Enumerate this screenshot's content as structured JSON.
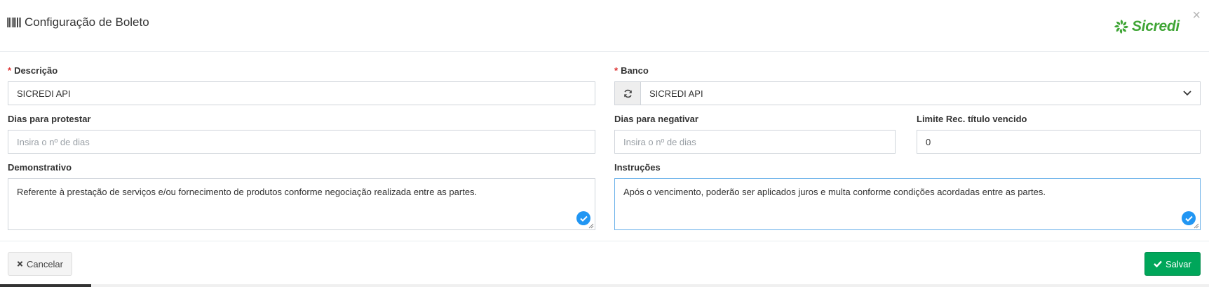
{
  "modal": {
    "title": "Configuração de Boleto",
    "close_symbol": "×",
    "brand": {
      "name": "Sicredi",
      "color": "#3fa535"
    }
  },
  "form": {
    "descricao": {
      "label": "Descrição",
      "required": "*",
      "value": "SICREDI API"
    },
    "banco": {
      "label": "Banco",
      "required": "*",
      "value": "SICREDI API"
    },
    "dias_protestar": {
      "label": "Dias para protestar",
      "placeholder": "Insira o nº de dias"
    },
    "dias_negativar": {
      "label": "Dias para negativar",
      "placeholder": "Insira o nº de dias"
    },
    "limite": {
      "label": "Limite Rec. título vencido",
      "value": "0"
    },
    "demonstrativo": {
      "label": "Demonstrativo",
      "value": "Referente à prestação de serviços e/ou fornecimento de produtos conforme negociação realizada entre as partes."
    },
    "instrucoes": {
      "label": "Instruções",
      "value": "Após o vencimento, poderão ser aplicados juros e multa conforme condições acordadas entre as partes."
    }
  },
  "footer": {
    "cancel_label": "Cancelar",
    "save_label": "Salvar",
    "save_color": "#00a65a"
  },
  "icons": {
    "title": "barcode-icon",
    "refresh": "refresh-icon",
    "cancel": "times-icon",
    "save": "check-icon",
    "field_ok": "check-circle-icon"
  }
}
